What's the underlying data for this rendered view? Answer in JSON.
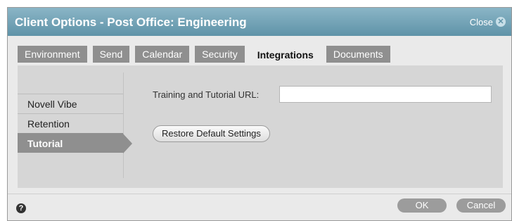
{
  "dialog": {
    "title": "Client Options - Post Office: Engineering",
    "close_label": "Close",
    "close_glyph": "✕"
  },
  "tabs": [
    {
      "label": "Environment"
    },
    {
      "label": "Send"
    },
    {
      "label": "Calendar"
    },
    {
      "label": "Security"
    },
    {
      "label": "Integrations",
      "active": true
    },
    {
      "label": "Documents"
    }
  ],
  "sidebar": {
    "items": [
      {
        "label": "Novell Vibe"
      },
      {
        "label": "Retention"
      },
      {
        "label": "Tutorial",
        "active": true
      }
    ]
  },
  "main": {
    "url_label": "Training and Tutorial URL:",
    "url_value": "",
    "restore_label": "Restore Default Settings"
  },
  "footer": {
    "help_glyph": "?",
    "ok_label": "OK",
    "cancel_label": "Cancel"
  },
  "colors": {
    "titlebar": "#5f93a8",
    "tab_inactive": "#8f8f8f",
    "panel": "#d6d6d6"
  }
}
